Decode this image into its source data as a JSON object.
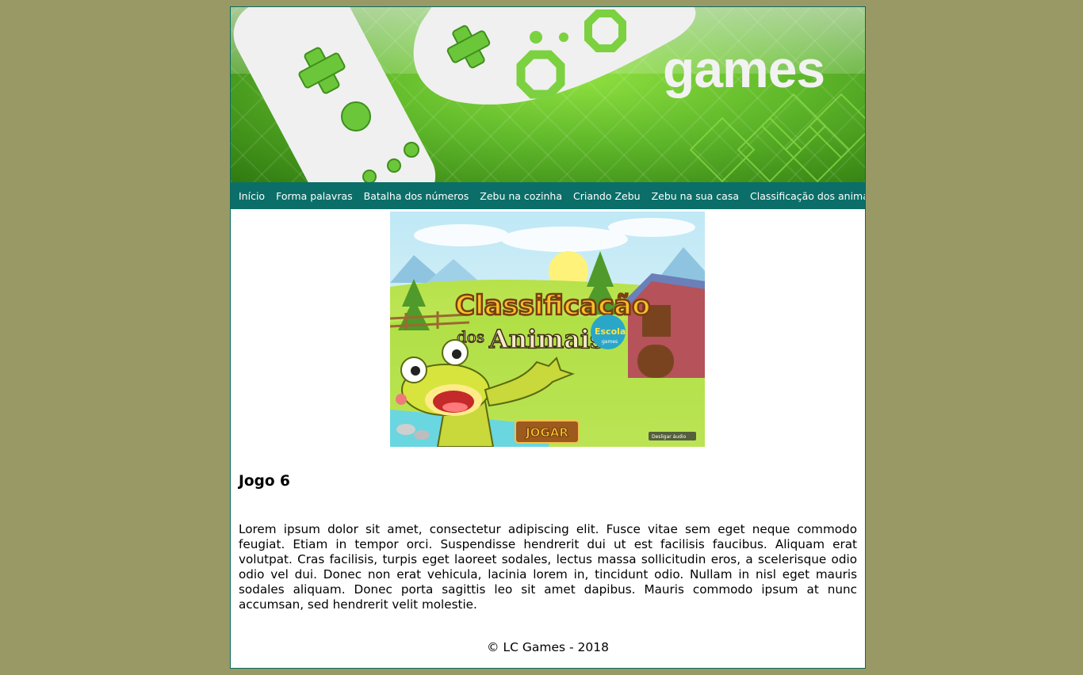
{
  "banner": {
    "title": "games"
  },
  "nav": {
    "items": [
      "Início",
      "Forma palavras",
      "Batalha dos números",
      "Zebu na cozinha",
      "Criando Zebu",
      "Zebu na sua casa",
      "Classificação dos animais"
    ]
  },
  "game": {
    "image": {
      "title_line1": "Classificação",
      "title_line2_dos": "dos",
      "title_line2_animais": "Animais",
      "brand": "Escola",
      "brand_sub": "games",
      "play_button": "JOGAR",
      "audio_toggle": "Desligar áudio"
    },
    "heading": "Jogo 6",
    "description": "Lorem ipsum dolor sit amet, consectetur adipiscing elit. Fusce vitae sem eget neque commodo feugiat. Etiam in tempor orci. Suspendisse hendrerit dui ut est facilisis faucibus. Aliquam erat volutpat. Cras facilisis, turpis eget laoreet sodales, lectus massa sollicitudin eros, a scelerisque odio odio vel dui. Donec non erat vehicula, lacinia lorem in, tincidunt odio. Nullam in nisl eget mauris sodales aliquam. Donec porta sagittis leo sit amet dapibus. Mauris commodo ipsum at nunc accumsan, sed hendrerit velit molestie."
  },
  "footer": {
    "text": "© LC Games - 2018"
  },
  "colors": {
    "background": "#999966",
    "nav_background": "#0b6e68",
    "banner_green": "#5fb82a",
    "page_background": "#ffffff"
  },
  "icons": [
    "gamepad-controller-icon",
    "frog-mascot-icon",
    "barn-icon"
  ]
}
